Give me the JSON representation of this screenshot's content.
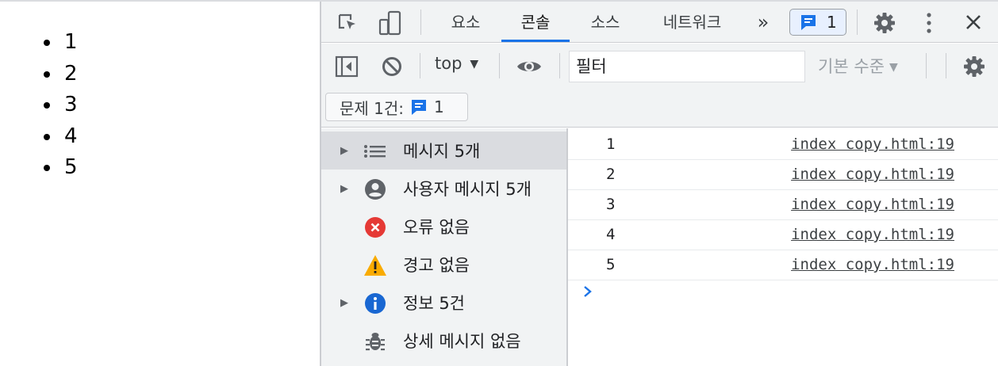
{
  "page": {
    "list_items": [
      "1",
      "2",
      "3",
      "4",
      "5"
    ]
  },
  "devtools": {
    "tabs": [
      {
        "label": "요소"
      },
      {
        "label": "콘솔"
      },
      {
        "label": "소스"
      },
      {
        "label": "네트워크"
      }
    ],
    "more_tabs_label": "»",
    "issue_count": "1",
    "toolbar": {
      "context": "top",
      "filter_value": "필터",
      "levels_label": "기본 수준"
    },
    "issues_button": {
      "label": "문제 1건:",
      "count": "1"
    },
    "sidebar": [
      {
        "label": "메시지 5개",
        "icon": "list-icon"
      },
      {
        "label": "사용자 메시지 5개",
        "icon": "user-icon"
      },
      {
        "label": "오류 없음",
        "icon": "error-icon"
      },
      {
        "label": "경고 없음",
        "icon": "warning-icon"
      },
      {
        "label": "정보 5건",
        "icon": "info-icon"
      },
      {
        "label": "상세 메시지 없음",
        "icon": "bug-icon"
      }
    ],
    "console_logs": [
      {
        "message": "1",
        "source": "index copy.html:19"
      },
      {
        "message": "2",
        "source": "index copy.html:19"
      },
      {
        "message": "3",
        "source": "index copy.html:19"
      },
      {
        "message": "4",
        "source": "index copy.html:19"
      },
      {
        "message": "5",
        "source": "index copy.html:19"
      }
    ]
  },
  "colors": {
    "accent": "#1a73e8",
    "error": "#d93025",
    "warning": "#f9ab00",
    "info": "#1967d2"
  }
}
